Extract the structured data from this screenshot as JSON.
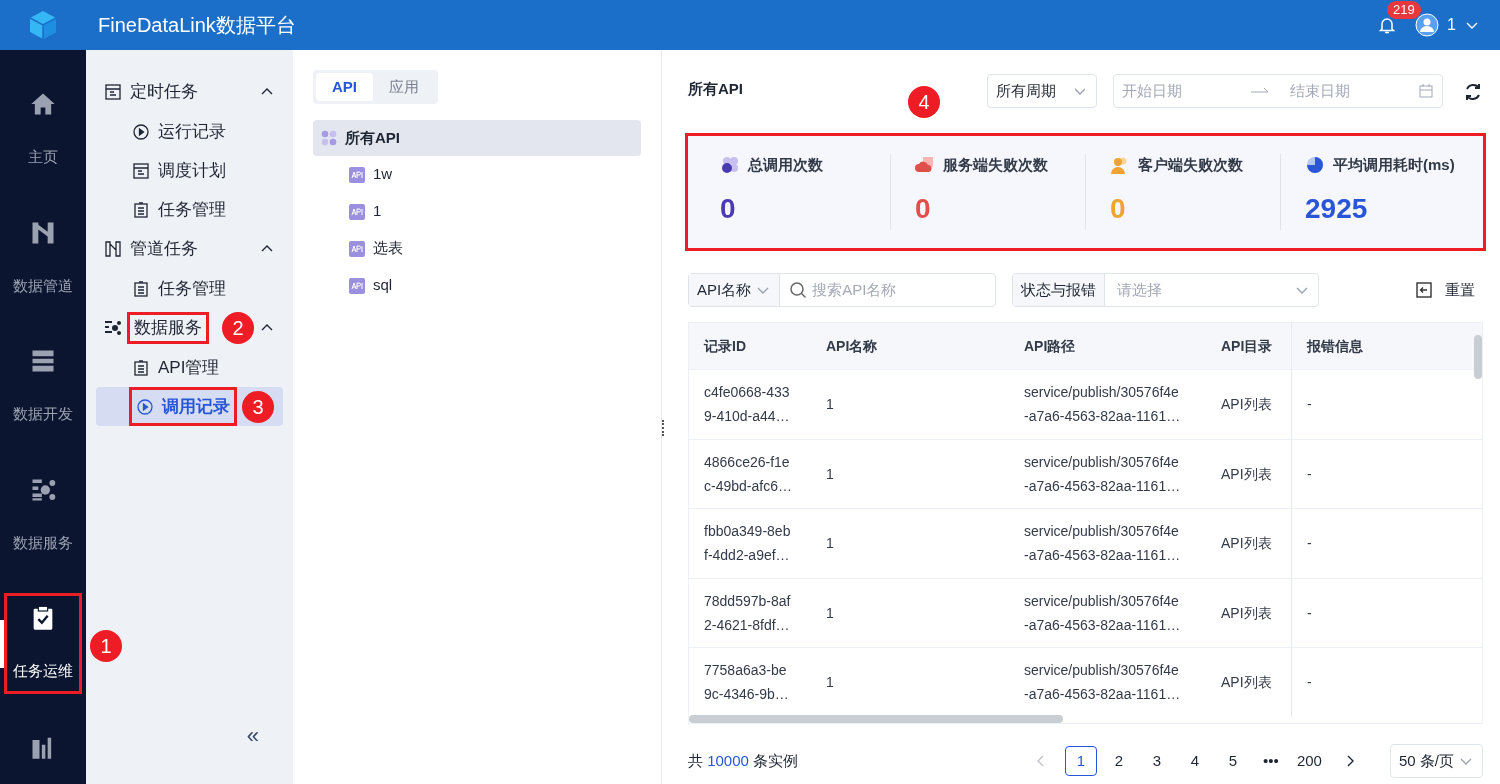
{
  "header": {
    "title": "FineDataLink数据平台",
    "notification_count": "219",
    "user": "1"
  },
  "rail": [
    {
      "label": "主页",
      "kind": "home",
      "selected": false
    },
    {
      "label": "数据管道",
      "kind": "pipe",
      "selected": false
    },
    {
      "label": "数据开发",
      "kind": "dev",
      "selected": false
    },
    {
      "label": "数据服务",
      "kind": "service",
      "selected": false
    },
    {
      "label": "任务运维",
      "kind": "ops",
      "selected": true,
      "callout": "1"
    },
    {
      "kind": "chart",
      "selected": false
    }
  ],
  "sidebar": {
    "groups": [
      {
        "label": "定时任务",
        "kind": "calendar",
        "expanded": true,
        "items": [
          {
            "label": "运行记录",
            "kind": "play",
            "selected": false
          },
          {
            "label": "调度计划",
            "kind": "calendar",
            "selected": false
          },
          {
            "label": "任务管理",
            "kind": "list",
            "selected": false
          }
        ]
      },
      {
        "label": "管道任务",
        "kind": "pipe",
        "expanded": true,
        "items": [
          {
            "label": "任务管理",
            "kind": "list",
            "selected": false
          }
        ]
      },
      {
        "label": "数据服务",
        "kind": "service",
        "expanded": true,
        "callout": "2",
        "items": [
          {
            "label": "API管理",
            "kind": "list",
            "selected": false
          },
          {
            "label": "调用记录",
            "kind": "play",
            "selected": true,
            "callout": "3"
          }
        ]
      }
    ],
    "collapse": "«"
  },
  "tree_panel": {
    "tabs": [
      {
        "label": "API",
        "selected": true
      },
      {
        "label": "应用",
        "selected": false
      }
    ],
    "root": {
      "label": "所有API",
      "selected": true,
      "children": [
        {
          "label": "1w"
        },
        {
          "label": "1"
        },
        {
          "label": "选表"
        },
        {
          "label": "sql"
        }
      ]
    }
  },
  "main": {
    "title": "所有API",
    "period": "所有周期",
    "start_placeholder": "开始日期",
    "end_placeholder": "结束日期",
    "callout": "4",
    "stats": [
      {
        "label": "总调用次数",
        "value": "0",
        "color": "#4b3bb0"
      },
      {
        "label": "服务端失败次数",
        "value": "0",
        "color": "#e0504b"
      },
      {
        "label": "客户端失败次数",
        "value": "0",
        "color": "#f0a232"
      },
      {
        "label": "平均调用耗时(ms)",
        "value": "2925",
        "color": "#2a55d6"
      }
    ],
    "filters": {
      "name_select": "API名称",
      "search_placeholder": "搜索API名称",
      "status_label": "状态与报错",
      "status_placeholder": "请选择",
      "reset": "重置"
    },
    "table": {
      "columns": [
        "记录ID",
        "API名称",
        "API路径",
        "API目录",
        "报错信息"
      ],
      "rows": [
        {
          "id": [
            "c4fe0668-433",
            "9-410d-a44…"
          ],
          "name": "1",
          "path": [
            "service/publish/30576f4e",
            "-a7a6-4563-82aa-1161…"
          ],
          "dir": "API列表",
          "error": "-"
        },
        {
          "id": [
            "4866ce26-f1e",
            "c-49bd-afc6…"
          ],
          "name": "1",
          "path": [
            "service/publish/30576f4e",
            "-a7a6-4563-82aa-1161…"
          ],
          "dir": "API列表",
          "error": "-"
        },
        {
          "id": [
            "fbb0a349-8eb",
            "f-4dd2-a9ef…"
          ],
          "name": "1",
          "path": [
            "service/publish/30576f4e",
            "-a7a6-4563-82aa-1161…"
          ],
          "dir": "API列表",
          "error": "-"
        },
        {
          "id": [
            "78dd597b-8af",
            "2-4621-8fdf…"
          ],
          "name": "1",
          "path": [
            "service/publish/30576f4e",
            "-a7a6-4563-82aa-1161…"
          ],
          "dir": "API列表",
          "error": "-"
        },
        {
          "id": [
            "7758a6a3-be",
            "9c-4346-9b…"
          ],
          "name": "1",
          "path": [
            "service/publish/30576f4e",
            "-a7a6-4563-82aa-1161…"
          ],
          "dir": "API列表",
          "error": "-"
        }
      ]
    },
    "pagination": {
      "total_prefix": "共",
      "total_count": "10000",
      "total_suffix": "条实例",
      "pages": [
        {
          "label": "1",
          "selected": true
        },
        {
          "label": "2",
          "selected": false
        },
        {
          "label": "3",
          "selected": false
        },
        {
          "label": "4",
          "selected": false
        },
        {
          "label": "5",
          "selected": false
        },
        {
          "label": "•••",
          "selected": false
        },
        {
          "label": "200",
          "selected": false
        }
      ],
      "page_size": "50 条/页"
    }
  }
}
